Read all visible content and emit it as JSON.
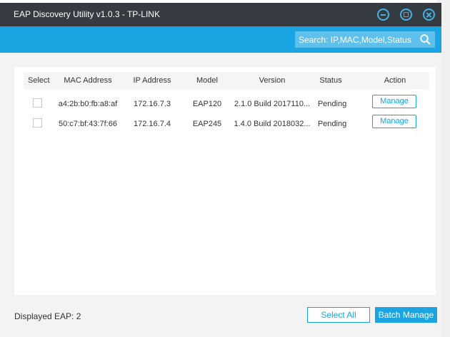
{
  "window": {
    "title": "EAP Discovery Utility v1.0.3 - TP-LINK"
  },
  "search": {
    "placeholder": "Search: IP,MAC,Model,Status"
  },
  "table": {
    "columns": [
      "Select",
      "MAC Address",
      "IP Address",
      "Model",
      "Version",
      "Status",
      "Action"
    ],
    "rows": [
      {
        "mac": "a4:2b:b0:fb:a8:af",
        "ip": "172.16.7.3",
        "model": "EAP120",
        "version": "2.1.0 Build 2017110...",
        "status": "Pending",
        "action": "Manage"
      },
      {
        "mac": "50:c7:bf:43:7f:66",
        "ip": "172.16.7.4",
        "model": "EAP245",
        "version": "1.4.0 Build 2018032...",
        "status": "Pending",
        "action": "Manage"
      }
    ]
  },
  "footer": {
    "displayed": "Displayed EAP: 2",
    "select_all": "Select All",
    "batch_manage": "Batch Manage"
  },
  "colors": {
    "titlebar": "#363b41",
    "accent": "#1aa4e1"
  }
}
